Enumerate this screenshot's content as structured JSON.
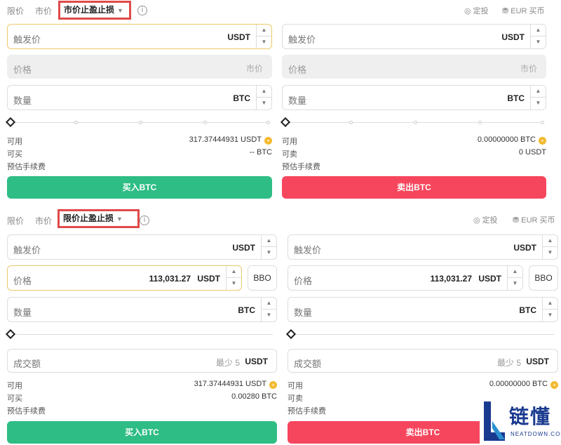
{
  "top": {
    "tabs": {
      "limit": "限价",
      "market": "市价",
      "selected": "市价止盈止损"
    },
    "tools": {
      "recurring": "定投",
      "eur": "EUR 买币"
    },
    "buy": {
      "trigger": {
        "label": "触发价",
        "unit": "USDT"
      },
      "price": {
        "label": "价格",
        "unit": "市价"
      },
      "amount": {
        "label": "数量",
        "unit": "BTC"
      },
      "available": {
        "label": "可用",
        "value": "317.37444931 USDT"
      },
      "can_trade": {
        "label": "可买",
        "value": "-- BTC"
      },
      "fee": {
        "label": "预估手续费"
      },
      "button": "买入BTC"
    },
    "sell": {
      "trigger": {
        "label": "触发价",
        "unit": "USDT"
      },
      "price": {
        "label": "价格",
        "unit": "市价"
      },
      "amount": {
        "label": "数量",
        "unit": "BTC"
      },
      "available": {
        "label": "可用",
        "value": "0.00000000 BTC"
      },
      "can_trade": {
        "label": "可卖",
        "value": "0 USDT"
      },
      "fee": {
        "label": "预估手续费"
      },
      "button": "卖出BTC"
    }
  },
  "bottom": {
    "tabs": {
      "limit": "限价",
      "market": "市价",
      "selected": "限价止盈止损"
    },
    "tools": {
      "recurring": "定投",
      "eur": "EUR 买币"
    },
    "buy": {
      "trigger": {
        "label": "触发价",
        "unit": "USDT"
      },
      "price": {
        "label": "价格",
        "value": "113,031.27",
        "unit": "USDT"
      },
      "bbo": "BBO",
      "amount": {
        "label": "数量",
        "unit": "BTC"
      },
      "total": {
        "label": "成交额",
        "min": "最少 5",
        "unit": "USDT"
      },
      "available": {
        "label": "可用",
        "value": "317.37444931 USDT"
      },
      "can_trade": {
        "label": "可买",
        "value": "0.00280 BTC"
      },
      "fee": {
        "label": "预估手续费"
      },
      "button": "买入BTC"
    },
    "sell": {
      "trigger": {
        "label": "触发价",
        "unit": "USDT"
      },
      "price": {
        "label": "价格",
        "value": "113,031.27",
        "unit": "USDT"
      },
      "bbo": "BBO",
      "amount": {
        "label": "数量",
        "unit": "BTC"
      },
      "total": {
        "label": "成交额",
        "min": "最少 5",
        "unit": "USDT"
      },
      "available": {
        "label": "可用",
        "value": "0.00000000 BTC"
      },
      "can_trade": {
        "label": "可卖",
        "value": ""
      },
      "fee": {
        "label": "预估手续费"
      },
      "button": "卖出BTC"
    }
  },
  "watermark": {
    "cn": "链懂",
    "en": "NEATDOWN.COM"
  },
  "icons": {
    "info": "info-icon",
    "recurring": "recurring-icon",
    "eur": "bag-icon",
    "coin": "coin-icon",
    "step_up": "chevron-up-icon",
    "step_down": "chevron-down-icon",
    "knob": "slider-diamond-icon"
  },
  "colors": {
    "buy": "#2ebd85",
    "sell": "#f6465d",
    "highlight": "#e04a4a",
    "focus": "#ecc96a",
    "coin": "#f3ba2f"
  }
}
